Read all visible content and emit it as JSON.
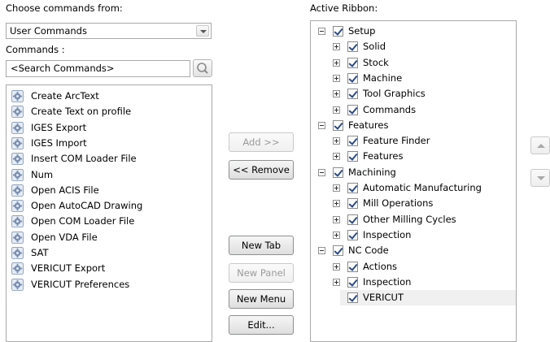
{
  "left": {
    "choose_label": "Choose commands from:",
    "choose_value": "User Commands",
    "commands_label": "Commands :",
    "search_placeholder": "<Search Commands>",
    "commands": [
      "Create ArcText",
      "Create Text on profile",
      "IGES Export",
      "IGES Import",
      "Insert COM Loader File",
      "Num",
      "Open ACIS File",
      "Open AutoCAD Drawing",
      "Open COM Loader File",
      "Open VDA File",
      "SAT",
      "VERICUT Export",
      "VERICUT Preferences"
    ]
  },
  "middle": {
    "add_label": "Add >>",
    "remove_label": "<< Remove",
    "new_tab_label": "New Tab",
    "new_panel_label": "New Panel",
    "new_menu_label": "New Menu",
    "edit_label": "Edit..."
  },
  "right": {
    "ribbon_label": "Active Ribbon:",
    "tree": [
      {
        "label": "Setup",
        "level": 0,
        "expander": "minus",
        "checked": true
      },
      {
        "label": "Solid",
        "level": 1,
        "expander": "plus",
        "checked": true
      },
      {
        "label": "Stock",
        "level": 1,
        "expander": "plus",
        "checked": true
      },
      {
        "label": "Machine",
        "level": 1,
        "expander": "plus",
        "checked": true
      },
      {
        "label": "Tool Graphics",
        "level": 1,
        "expander": "plus",
        "checked": true
      },
      {
        "label": "Commands",
        "level": 1,
        "expander": "plus",
        "checked": true
      },
      {
        "label": "Features",
        "level": 0,
        "expander": "minus",
        "checked": true
      },
      {
        "label": "Feature Finder",
        "level": 1,
        "expander": "plus",
        "checked": true
      },
      {
        "label": "Features",
        "level": 1,
        "expander": "plus",
        "checked": true
      },
      {
        "label": "Machining",
        "level": 0,
        "expander": "minus",
        "checked": true
      },
      {
        "label": "Automatic Manufacturing",
        "level": 1,
        "expander": "plus",
        "checked": true
      },
      {
        "label": "Mill Operations",
        "level": 1,
        "expander": "plus",
        "checked": true
      },
      {
        "label": "Other Milling Cycles",
        "level": 1,
        "expander": "plus",
        "checked": true
      },
      {
        "label": "Inspection",
        "level": 1,
        "expander": "plus",
        "checked": true
      },
      {
        "label": "NC Code",
        "level": 0,
        "expander": "minus",
        "checked": true
      },
      {
        "label": "Actions",
        "level": 1,
        "expander": "plus",
        "checked": true
      },
      {
        "label": "Inspection",
        "level": 1,
        "expander": "plus",
        "checked": true
      },
      {
        "label": "VERICUT",
        "level": 1,
        "expander": "none",
        "checked": true,
        "selected": true
      }
    ]
  },
  "icons": {
    "command_icon": "gear-icon",
    "search_icon": "magnifier-icon",
    "move_up_icon": "triangle-up-icon",
    "move_down_icon": "triangle-down-icon"
  }
}
